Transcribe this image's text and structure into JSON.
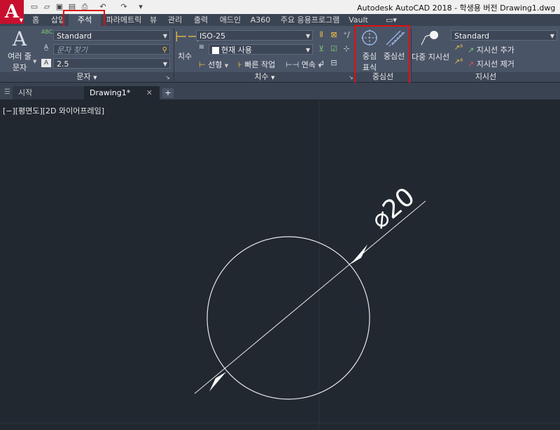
{
  "app": {
    "logo": "A",
    "title": "Autodesk AutoCAD 2018 - 학생용 버전     Drawing1.dwg"
  },
  "quick_access": [
    "new-icon",
    "open-icon",
    "save-icon",
    "saveas-icon",
    "plot-icon",
    "undo-icon",
    "redo-icon"
  ],
  "ribbon_tabs": [
    {
      "label": "홈"
    },
    {
      "label": "삽입"
    },
    {
      "label": "주석",
      "active": true
    },
    {
      "label": "파라메트릭"
    },
    {
      "label": "뷰"
    },
    {
      "label": "관리"
    },
    {
      "label": "출력"
    },
    {
      "label": "애드인"
    },
    {
      "label": "A360"
    },
    {
      "label": "주요 응용프로그램"
    },
    {
      "label": "Vault"
    }
  ],
  "text_panel": {
    "big_button_line1": "여러 줄",
    "big_button_line2": "문자",
    "style_value": "Standard",
    "find_placeholder": "문자 찾기",
    "height_value": "2.5",
    "panel_label": "문자"
  },
  "dim_panel": {
    "big_button": "치수",
    "style_value": "ISO-25",
    "layer_value": "현재 사용",
    "linear": "선형",
    "quick": "빠른 작업",
    "continue": "연속",
    "panel_label": "치수"
  },
  "center_panel": {
    "center_mark_line1": "중심",
    "center_mark_line2": "표식",
    "centerline": "중심선",
    "panel_label": "중심선"
  },
  "leader_panel": {
    "multileader": "다중 지시선",
    "style_value": "Standard",
    "add": "지시선 추가",
    "remove": "지시선 제거",
    "panel_label": "지시선"
  },
  "doc_tabs": [
    {
      "label": "시작"
    },
    {
      "label": "Drawing1*",
      "active": true
    }
  ],
  "viewport": {
    "label": "[−][평면도][2D 와이어프레임]"
  },
  "dimension_text": "⌀20",
  "colors": {
    "canvas": "#212830",
    "ribbon": "#4a5467",
    "highlight": "#e01010",
    "logo": "#c8102e"
  }
}
